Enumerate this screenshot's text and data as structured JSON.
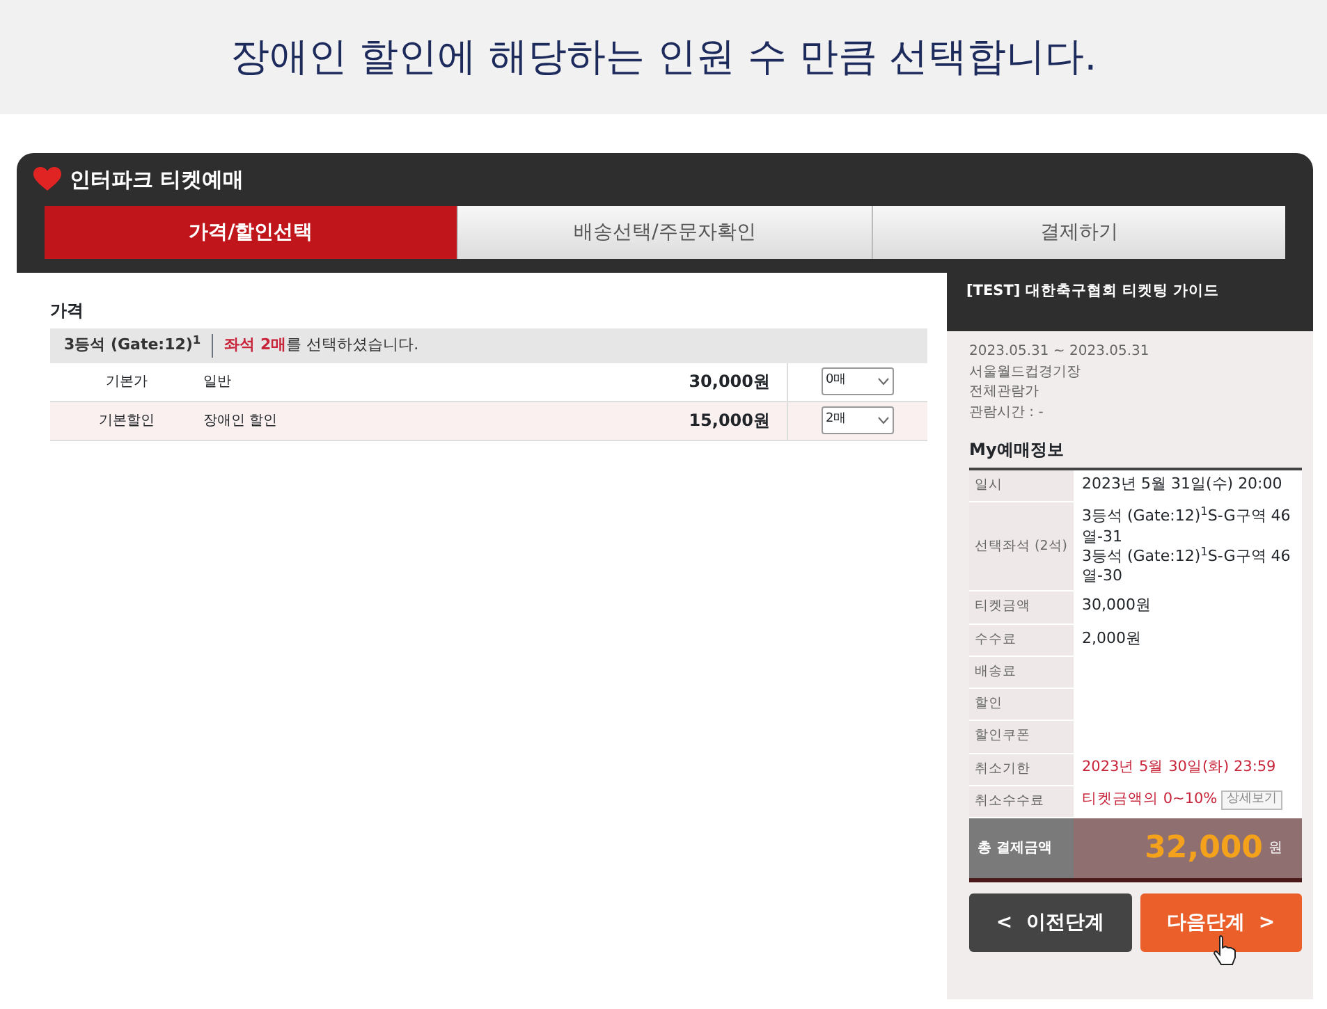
{
  "caption": "장애인 할인에 해당하는 인원 수 만큼 선택합니다.",
  "window": {
    "title": "인터파크 티켓예매"
  },
  "steps": [
    {
      "label": "가격/할인선택",
      "selected": true
    },
    {
      "label": "배송선택/주문자확인",
      "selected": false
    },
    {
      "label": "결제하기",
      "selected": false
    }
  ],
  "price": {
    "heading": "가격",
    "seat_grade": "3등석 (Gate:12)$^{1}$",
    "notice_highlight": "좌석 2매",
    "notice_rest": "를 선택하셨습니다.",
    "rows": [
      {
        "type": "기본가",
        "name": "일반",
        "price": "30,000원",
        "quantity": "0매",
        "selected": false
      },
      {
        "type": "기본할인",
        "name": "장애인 할인",
        "price": "15,000원",
        "quantity": "2매",
        "selected": true
      }
    ]
  },
  "sidebar": {
    "title": "[TEST] 대한축구협회 티켓팅 가이드",
    "date_range": "2023.05.31 ~ 2023.05.31",
    "venue": "서울월드컵경기장",
    "rating": "전체관람가",
    "duration": "관람시간 : -",
    "my_heading": "My예매정보",
    "info": [
      {
        "label": "일시",
        "kind": "plain",
        "values": [
          "2023년 5월 31일(수) 20:00"
        ]
      },
      {
        "label": "선택좌석 (2석)",
        "kind": "plain",
        "values": [
          "3등석 (Gate:12)$^{1}$S-G구역 46열-31",
          "3등석 (Gate:12)$^{1}$S-G구역 46열-30"
        ]
      },
      {
        "label": "티켓금액",
        "kind": "plain",
        "values": [
          "30,000원"
        ]
      },
      {
        "label": "수수료",
        "kind": "plain",
        "values": [
          "2,000원"
        ]
      },
      {
        "label": "배송료",
        "kind": "plain"
      },
      {
        "label": "할인",
        "kind": "plain"
      },
      {
        "label": "할인쿠폰",
        "kind": "plain"
      },
      {
        "label": "취소기한",
        "kind": "alert",
        "values": [
          "2023년 5월 30일(화) 23:59"
        ]
      },
      {
        "label": "취소수수료",
        "kind": "alert",
        "values": [
          "티켓금액의 0~10%"
        ],
        "button": "상세보기"
      }
    ],
    "total_label": "총 결제금액",
    "total_amount": "32,000",
    "total_unit": "원",
    "prev_button": {
      "arrow": "<",
      "label": "이전단계"
    },
    "next_button": {
      "label": "다음단계",
      "arrow": ">"
    }
  }
}
